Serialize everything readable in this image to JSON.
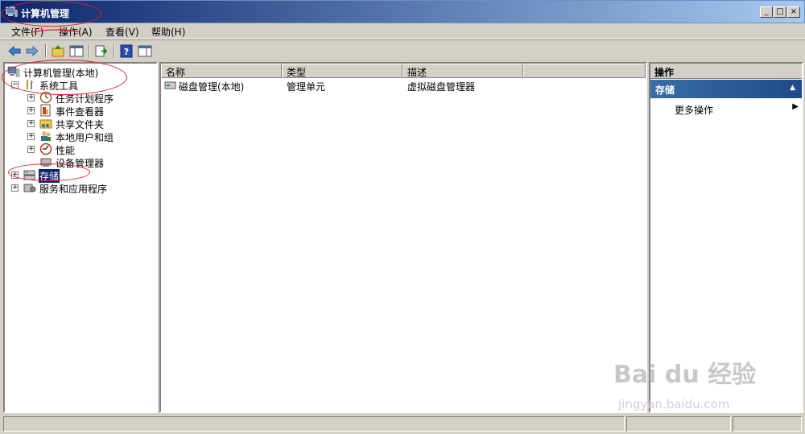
{
  "window": {
    "title": "计算机管理",
    "minimize": "_",
    "maximize": "□",
    "close": "×"
  },
  "menubar": [
    "文件(F)",
    "操作(A)",
    "查看(V)",
    "帮助(H)"
  ],
  "toolbar": {
    "icons": [
      "back-arrow-icon",
      "forward-arrow-icon",
      "up-folder-icon",
      "show-hide-tree-icon",
      "export-list-icon",
      "help-icon",
      "properties-icon"
    ]
  },
  "tree": {
    "root": "计算机管理(本地)",
    "system_tools": "系统工具",
    "children": [
      "任务计划程序",
      "事件查看器",
      "共享文件夹",
      "本地用户和组",
      "性能",
      "设备管理器"
    ],
    "storage": "存储",
    "services": "服务和应用程序",
    "expander_plus": "+",
    "expander_minus": "−"
  },
  "list": {
    "columns": [
      "名称",
      "类型",
      "描述"
    ],
    "rows": [
      {
        "name": "磁盘管理(本地)",
        "type": "管理单元",
        "desc": "虚拟磁盘管理器"
      }
    ]
  },
  "actions": {
    "header": "操作",
    "section": "存储",
    "section_arrow": "▲",
    "item": "更多操作",
    "item_arrow": "▶"
  },
  "watermark": {
    "main": "Bai du 经验",
    "sub": "jingyan.baidu.com"
  },
  "colors": {
    "selection": "#0a246a",
    "title_bar": "#0a246a",
    "annotation": "#e02020"
  }
}
